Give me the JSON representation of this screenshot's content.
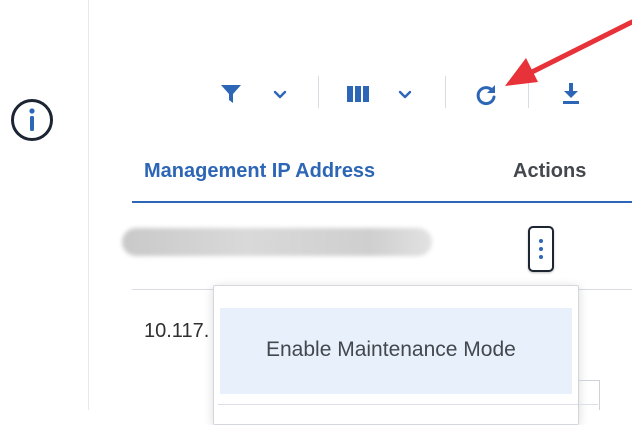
{
  "table": {
    "columns": [
      "Management IP Address",
      "Actions"
    ],
    "rows": [
      {
        "ip": "",
        "redacted": true
      },
      {
        "ip": "10.117."
      }
    ]
  },
  "toolbar": {
    "icons": [
      "filter-icon",
      "chevron-down-icon",
      "columns-icon",
      "chevron-down-icon",
      "refresh-icon",
      "download-icon"
    ]
  },
  "context_menu": {
    "items": [
      {
        "label": "Enable Maintenance Mode"
      }
    ]
  },
  "colors": {
    "accent": "#2d66b6",
    "annotation_arrow": "#e8323a",
    "menu_highlight": "#e8f0fb"
  }
}
